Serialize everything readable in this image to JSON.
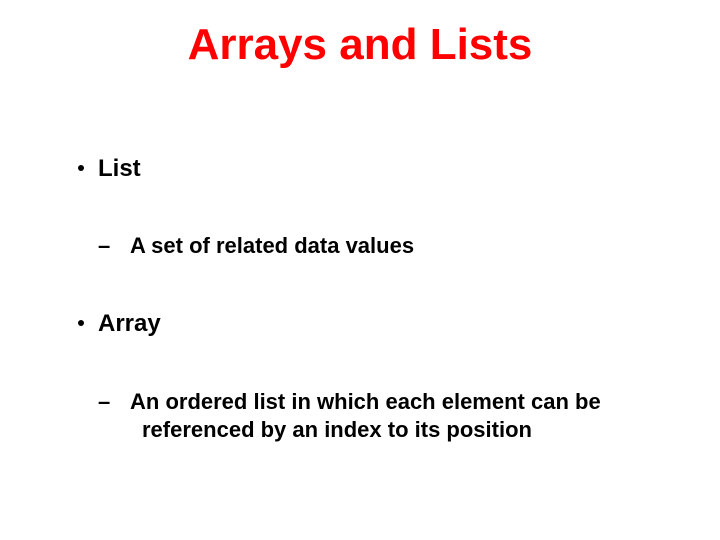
{
  "title": "Arrays and Lists",
  "bullets": [
    {
      "label": "List",
      "sub": "A set of related data values"
    },
    {
      "label": "Array",
      "sub": "An ordered list in which each element can be referenced by an index to its position"
    }
  ]
}
